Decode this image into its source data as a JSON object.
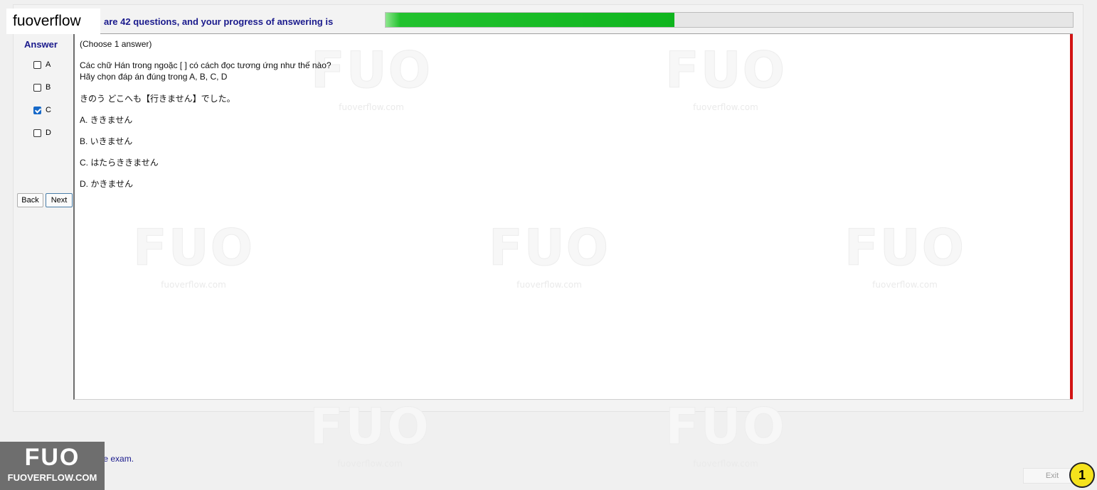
{
  "brand_top": "fuoverflow",
  "header": {
    "text": "are 42 questions, and your progress of answering is",
    "progress_percent": 42
  },
  "answer_panel": {
    "title": "Answer",
    "options": [
      {
        "label": "A",
        "checked": false
      },
      {
        "label": "B",
        "checked": false
      },
      {
        "label": "C",
        "checked": true
      },
      {
        "label": "D",
        "checked": false
      }
    ],
    "back_label": "Back",
    "next_label": "Next"
  },
  "question": {
    "instruction": "(Choose 1 answer)",
    "prompt_line1": "Các chữ Hán trong ngoặc [    ]  có cách đọc tương ứng như thế nào?",
    "prompt_line2": "Hãy chọn đáp án đúng trong A, B, C, D",
    "sentence": "きのう  どこへも【行きません】でした。",
    "choices": [
      "A.  ききません",
      "B.  いきません",
      "C.  はたらききません",
      "D.  かきません"
    ]
  },
  "watermark": {
    "mark": "FUO",
    "url": "fuoverflow.com"
  },
  "footer": {
    "finish_text": "want to finish the exam.",
    "logo_mark": "FUO",
    "logo_text": "FUOVERFLOW.COM",
    "exit_label": "Exit",
    "badge_number": "1"
  },
  "colors": {
    "accent_blue": "#1a1a8c",
    "progress_green": "#0fb51e",
    "scroll_red": "#d21414",
    "badge_yellow": "#f6e31c"
  }
}
